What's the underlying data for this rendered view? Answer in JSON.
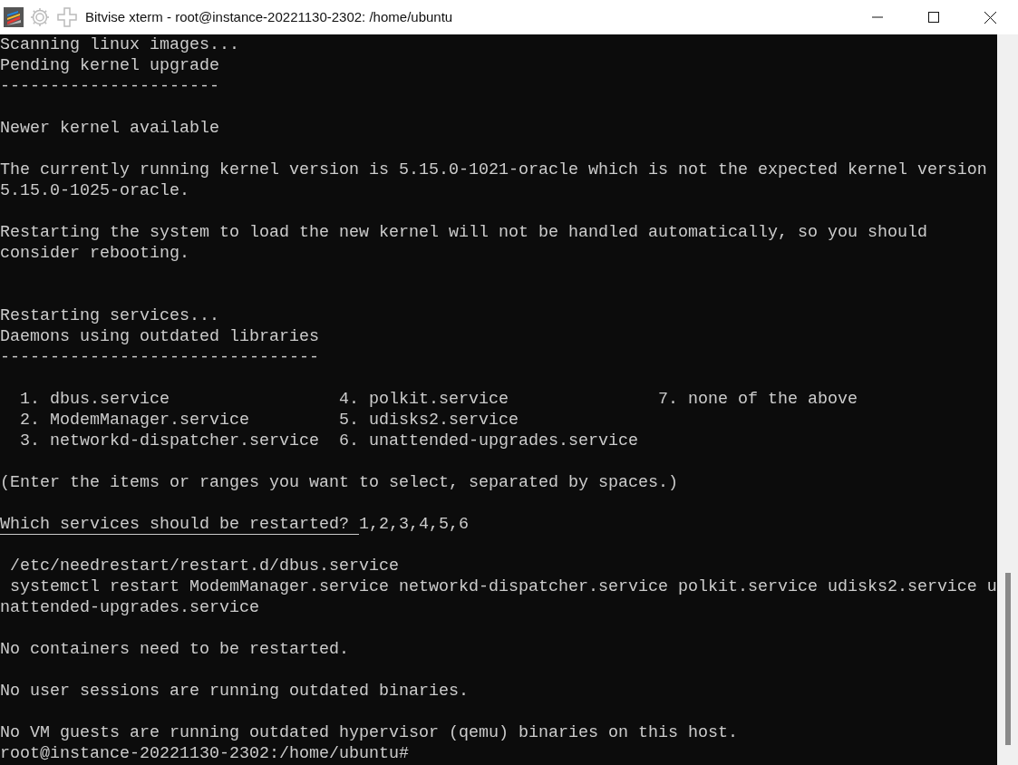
{
  "window": {
    "title": "Bitvise xterm - root@instance-20221130-2302: /home/ubuntu"
  },
  "terminal": {
    "lines": [
      {
        "kind": "text",
        "text": "Scanning linux images..."
      },
      {
        "kind": "text",
        "text": "Pending kernel upgrade"
      },
      {
        "kind": "text",
        "text": "----------------------"
      },
      {
        "kind": "blank"
      },
      {
        "kind": "text",
        "text": "Newer kernel available"
      },
      {
        "kind": "blank"
      },
      {
        "kind": "text",
        "text": "The currently running kernel version is 5.15.0-1021-oracle which is not the expected kernel version"
      },
      {
        "kind": "text",
        "text": "5.15.0-1025-oracle."
      },
      {
        "kind": "blank"
      },
      {
        "kind": "text",
        "text": "Restarting the system to load the new kernel will not be handled automatically, so you should"
      },
      {
        "kind": "text",
        "text": "consider rebooting."
      },
      {
        "kind": "blank"
      },
      {
        "kind": "blank"
      },
      {
        "kind": "text",
        "text": "Restarting services..."
      },
      {
        "kind": "text",
        "text": "Daemons using outdated libraries"
      },
      {
        "kind": "text",
        "text": "--------------------------------"
      },
      {
        "kind": "blank"
      },
      {
        "kind": "text",
        "text": "  1. dbus.service                 4. polkit.service               7. none of the above"
      },
      {
        "kind": "text",
        "text": "  2. ModemManager.service         5. udisks2.service"
      },
      {
        "kind": "text",
        "text": "  3. networkd-dispatcher.service  6. unattended-upgrades.service"
      },
      {
        "kind": "blank"
      },
      {
        "kind": "text",
        "text": "(Enter the items or ranges you want to select, separated by spaces.)"
      },
      {
        "kind": "blank"
      },
      {
        "kind": "question",
        "text": "Which services should be restarted?",
        "answer": "1,2,3,4,5,6"
      },
      {
        "kind": "blank"
      },
      {
        "kind": "text",
        "text": " /etc/needrestart/restart.d/dbus.service"
      },
      {
        "kind": "text",
        "text": " systemctl restart ModemManager.service networkd-dispatcher.service polkit.service udisks2.service u"
      },
      {
        "kind": "text",
        "text": "nattended-upgrades.service"
      },
      {
        "kind": "blank"
      },
      {
        "kind": "text",
        "text": "No containers need to be restarted."
      },
      {
        "kind": "blank"
      },
      {
        "kind": "text",
        "text": "No user sessions are running outdated binaries."
      },
      {
        "kind": "blank"
      },
      {
        "kind": "text",
        "text": "No VM guests are running outdated hypervisor (qemu) binaries on this host."
      },
      {
        "kind": "text",
        "text": "root@instance-20221130-2302:/home/ubuntu#"
      }
    ]
  }
}
